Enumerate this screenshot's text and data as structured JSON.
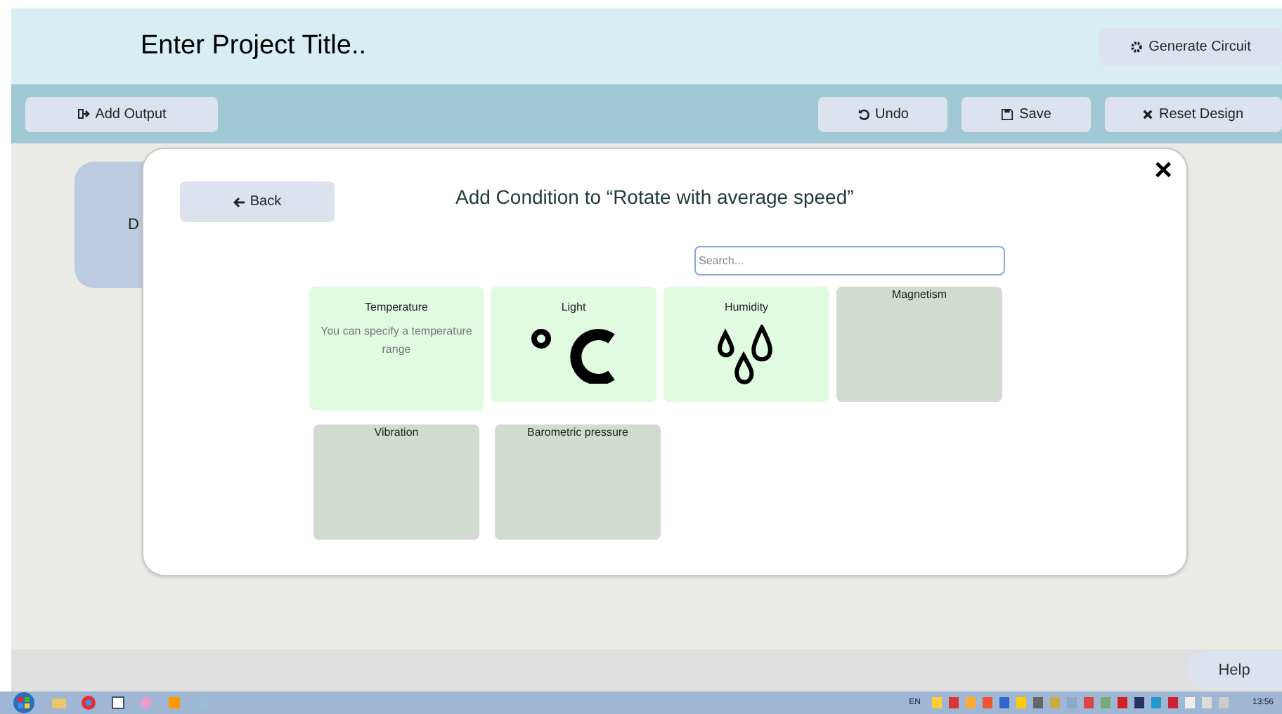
{
  "header": {
    "title": "Enter Project Title..",
    "generate_button": "Generate Circuit"
  },
  "toolbar": {
    "add_output": "Add Output",
    "undo": "Undo",
    "save": "Save",
    "reset": "Reset Design"
  },
  "background_card": {
    "label": "D"
  },
  "dialog": {
    "back": "Back",
    "title": "Add Condition to “Rotate with average speed”",
    "close": "×",
    "search": {
      "placeholder": "Search..."
    },
    "conditions": [
      {
        "name": "Temperature",
        "available": true,
        "kind": "description",
        "description": "You can specify a temperature range"
      },
      {
        "name": "Light",
        "available": true,
        "kind": "degrees"
      },
      {
        "name": "Humidity",
        "available": true,
        "kind": "drops"
      },
      {
        "name": "Magnetism",
        "available": false,
        "kind": "plain"
      },
      {
        "name": "Vibration",
        "available": false,
        "kind": "plain"
      },
      {
        "name": "Barometric pressure",
        "available": false,
        "kind": "plain"
      }
    ]
  },
  "help": "Help",
  "taskbar": {
    "language": "EN",
    "clock": "13:56"
  }
}
